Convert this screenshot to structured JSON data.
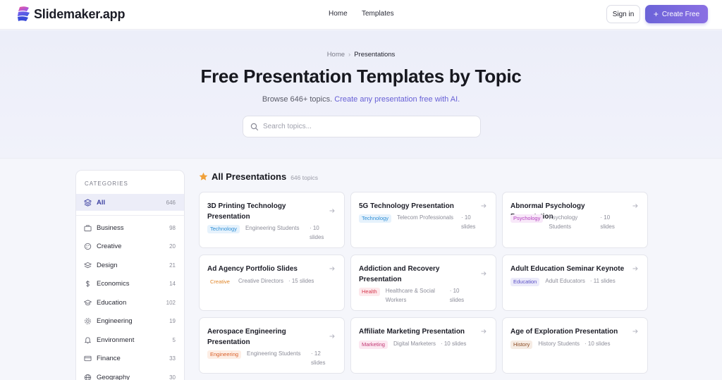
{
  "brand": {
    "name": "Slidemaker.app"
  },
  "nav": {
    "home": "Home",
    "templates": "Templates"
  },
  "header": {
    "signin": "Sign in",
    "create": "Create Free",
    "create_plus": "+"
  },
  "breadcrumb": {
    "home": "Home",
    "sep": "›",
    "current": "Presentations"
  },
  "hero": {
    "title": "Free Presentation Templates by Topic",
    "subtitle": "Browse 646+ topics.",
    "subtitle_link": "Create any presentation free with AI."
  },
  "search": {
    "placeholder": "Search topics...",
    "value": ""
  },
  "categories": {
    "heading": "CATEGORIES",
    "items": [
      {
        "label": "All",
        "count": "646",
        "icon": "stack-icon",
        "active": true
      },
      {
        "label": "Business",
        "count": "98",
        "icon": "briefcase-icon"
      },
      {
        "label": "Creative",
        "count": "20",
        "icon": "palette-icon"
      },
      {
        "label": "Design",
        "count": "21",
        "icon": "layers-icon"
      },
      {
        "label": "Economics",
        "count": "14",
        "icon": "dollar-icon"
      },
      {
        "label": "Education",
        "count": "102",
        "icon": "graduation-cap-icon"
      },
      {
        "label": "Engineering",
        "count": "19",
        "icon": "gear-icon"
      },
      {
        "label": "Environment",
        "count": "5",
        "icon": "bell-icon"
      },
      {
        "label": "Finance",
        "count": "33",
        "icon": "card-icon"
      },
      {
        "label": "Geography",
        "count": "30",
        "icon": "globe-icon"
      }
    ]
  },
  "main": {
    "section_title": "All Presentations",
    "section_count": "646 topics",
    "cards": [
      {
        "title": "3D Printing Technology Presentation",
        "tag": "Technology",
        "audience": "Engineering Students",
        "slides": "· 10 slides",
        "tag_color": "#2f8fd6",
        "tag_bg": "#e6f2fc"
      },
      {
        "title": "5G Technology Presentation",
        "tag": "Technology",
        "audience": "Telecom Professionals",
        "slides": "· 10 slides",
        "tag_color": "#2f8fd6",
        "tag_bg": "#e6f2fc"
      },
      {
        "title": "Abnormal Psychology Presentation",
        "tag": "Psychology",
        "audience": "Psychology Students",
        "slides": "· 10 slides",
        "tag_color": "#b23fbd",
        "tag_bg": "#f8e8f9"
      },
      {
        "title": "Ad Agency Portfolio Slides",
        "tag": "Creative",
        "audience": "Creative Directors",
        "slides": "· 15 slides",
        "tag_color": "#e0862a",
        "tag_bg": "#ffffff"
      },
      {
        "title": "Addiction and Recovery Presentation",
        "tag": "Health",
        "audience": "Healthcare & Social Workers",
        "slides": "· 10 slides",
        "tag_color": "#d6394f",
        "tag_bg": "#fde9ec"
      },
      {
        "title": "Adult Education Seminar Keynote",
        "tag": "Education",
        "audience": "Adult Educators",
        "slides": "· 11 slides",
        "tag_color": "#5a4fc6",
        "tag_bg": "#ecebfa"
      },
      {
        "title": "Aerospace Engineering Presentation",
        "tag": "Engineering",
        "audience": "Engineering Students",
        "slides": "· 12 slides",
        "tag_color": "#d9602a",
        "tag_bg": "#fdeee5"
      },
      {
        "title": "Affiliate Marketing Presentation",
        "tag": "Marketing",
        "audience": "Digital Marketers",
        "slides": "· 10 slides",
        "tag_color": "#c23a74",
        "tag_bg": "#fce8f1"
      },
      {
        "title": "Age of Exploration Presentation",
        "tag": "History",
        "audience": "History Students",
        "slides": "· 10 slides",
        "tag_color": "#8a4b23",
        "tag_bg": "#f6ece4"
      }
    ]
  },
  "colors": {
    "accent": "#6b63d8",
    "star": "#f0a13a"
  }
}
